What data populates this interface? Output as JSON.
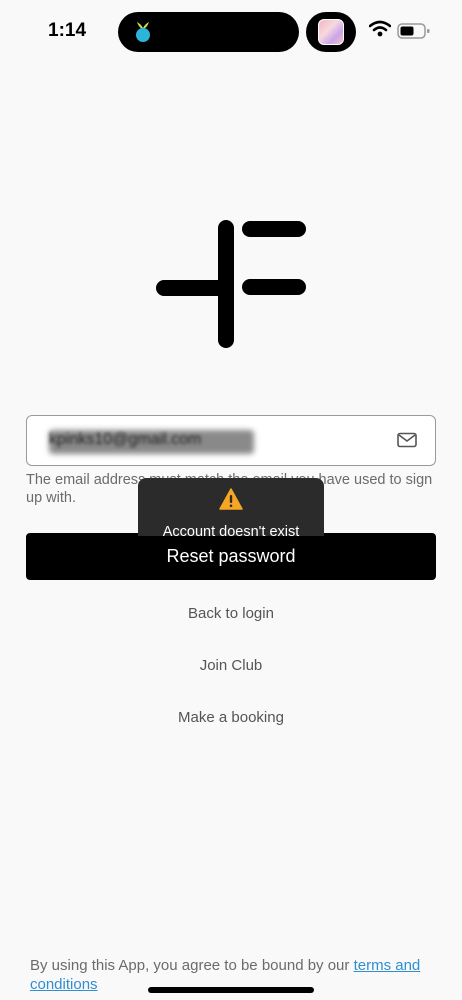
{
  "status_bar": {
    "time": "1:14"
  },
  "form": {
    "email_value": "kpinks10@gmail.com",
    "hint": "The email address must match the email you have used to sign up with.",
    "reset_label": "Reset password"
  },
  "toast": {
    "message": "Account doesn't exist"
  },
  "links": {
    "back_to_login": "Back to login",
    "join_club": "Join Club",
    "make_booking": "Make a booking"
  },
  "footer": {
    "text": "By using this App, you agree to be bound by our ",
    "terms_link": "terms and conditions"
  },
  "colors": {
    "accent_link": "#2f8fd0",
    "button_bg": "#000000",
    "toast_bg": "#2b2b2b",
    "warning": "#f5a623"
  }
}
